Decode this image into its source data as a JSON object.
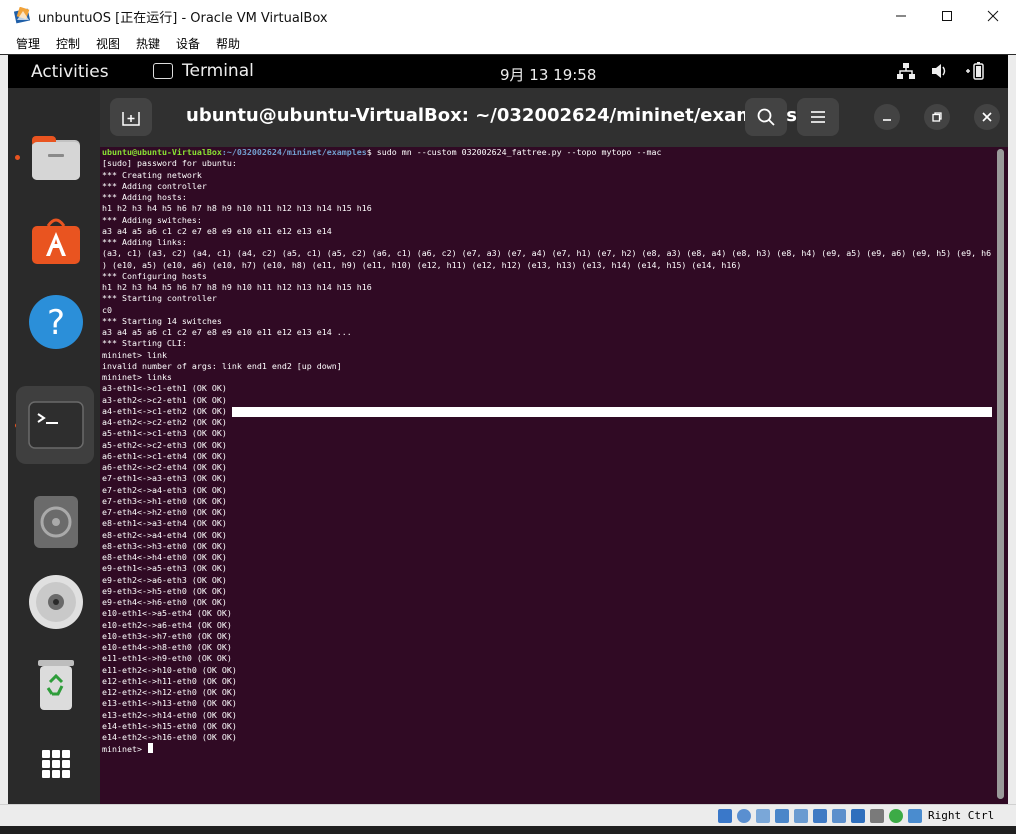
{
  "window": {
    "title": "unbuntuOS [正在运行] - Oracle VM VirtualBox",
    "menu": [
      "管理",
      "控制",
      "视图",
      "热键",
      "设备",
      "帮助"
    ]
  },
  "gnome": {
    "activities": "Activities",
    "app_name": "Terminal",
    "clock": "9月 13  19:58"
  },
  "terminal": {
    "title": "ubuntu@ubuntu-VirtualBox: ~/032002624/mininet/examples",
    "prompt_user": "ubuntu@ubuntu-VirtualBox",
    "prompt_path": ":~/032002624/mininet/examples",
    "command": "$ sudo mn --custom 032002624_fattree.py --topo mytopo --mac",
    "lines": [
      "[sudo] password for ubuntu:",
      "*** Creating network",
      "*** Adding controller",
      "*** Adding hosts:",
      "h1 h2 h3 h4 h5 h6 h7 h8 h9 h10 h11 h12 h13 h14 h15 h16",
      "*** Adding switches:",
      "a3 a4 a5 a6 c1 c2 e7 e8 e9 e10 e11 e12 e13 e14",
      "*** Adding links:",
      "(a3, c1) (a3, c2) (a4, c1) (a4, c2) (a5, c1) (a5, c2) (a6, c1) (a6, c2) (e7, a3) (e7, a4) (e7, h1) (e7, h2) (e8, a3) (e8, a4) (e8, h3) (e8, h4) (e9, a5) (e9, a6) (e9, h5) (e9, h6",
      ") (e10, a5) (e10, a6) (e10, h7) (e10, h8) (e11, h9) (e11, h10) (e12, h11) (e12, h12) (e13, h13) (e13, h14) (e14, h15) (e14, h16)",
      "*** Configuring hosts",
      "h1 h2 h3 h4 h5 h6 h7 h8 h9 h10 h11 h12 h13 h14 h15 h16",
      "*** Starting controller",
      "c0",
      "*** Starting 14 switches",
      "a3 a4 a5 a6 c1 c2 e7 e8 e9 e10 e11 e12 e13 e14 ...",
      "*** Starting CLI:",
      "mininet> link",
      "invalid number of args: link end1 end2 [up down]",
      "mininet> links",
      "a3-eth1<->c1-eth1 (OK OK)",
      "a3-eth2<->c2-eth1 (OK OK)",
      "a4-eth1<->c1-eth2 (OK OK)",
      "a4-eth2<->c2-eth2 (OK OK)",
      "a5-eth1<->c1-eth3 (OK OK)",
      "a5-eth2<->c2-eth3 (OK OK)",
      "a6-eth1<->c1-eth4 (OK OK)",
      "a6-eth2<->c2-eth4 (OK OK)",
      "e7-eth1<->a3-eth3 (OK OK)",
      "e7-eth2<->a4-eth3 (OK OK)",
      "e7-eth3<->h1-eth0 (OK OK)",
      "e7-eth4<->h2-eth0 (OK OK)",
      "e8-eth1<->a3-eth4 (OK OK)",
      "e8-eth2<->a4-eth4 (OK OK)",
      "e8-eth3<->h3-eth0 (OK OK)",
      "e8-eth4<->h4-eth0 (OK OK)",
      "e9-eth1<->a5-eth3 (OK OK)",
      "e9-eth2<->a6-eth3 (OK OK)",
      "e9-eth3<->h5-eth0 (OK OK)",
      "e9-eth4<->h6-eth0 (OK OK)",
      "e10-eth1<->a5-eth4 (OK OK)",
      "e10-eth2<->a6-eth4 (OK OK)",
      "e10-eth3<->h7-eth0 (OK OK)",
      "e10-eth4<->h8-eth0 (OK OK)",
      "e11-eth1<->h9-eth0 (OK OK)",
      "e11-eth2<->h10-eth0 (OK OK)",
      "e12-eth1<->h11-eth0 (OK OK)",
      "e12-eth2<->h12-eth0 (OK OK)",
      "e13-eth1<->h13-eth0 (OK OK)",
      "e13-eth2<->h14-eth0 (OK OK)",
      "e14-eth1<->h15-eth0 (OK OK)",
      "e14-eth2<->h16-eth0 (OK OK)"
    ],
    "final_prompt": "mininet> "
  },
  "statusbar": {
    "host_key": "Right Ctrl"
  },
  "colors": {
    "terminal_bg": "#300a24",
    "prompt_user": "#8ae234",
    "prompt_path": "#729fcf",
    "ubuntu_accent": "#e95420"
  },
  "icons": {
    "dock": [
      "files-icon",
      "app-store-icon",
      "help-icon",
      "terminal-icon",
      "disc-installer-icon",
      "cd-icon",
      "trash-icon",
      "app-grid-icon"
    ],
    "tray": [
      "network-icon",
      "volume-icon",
      "battery-icon"
    ]
  }
}
